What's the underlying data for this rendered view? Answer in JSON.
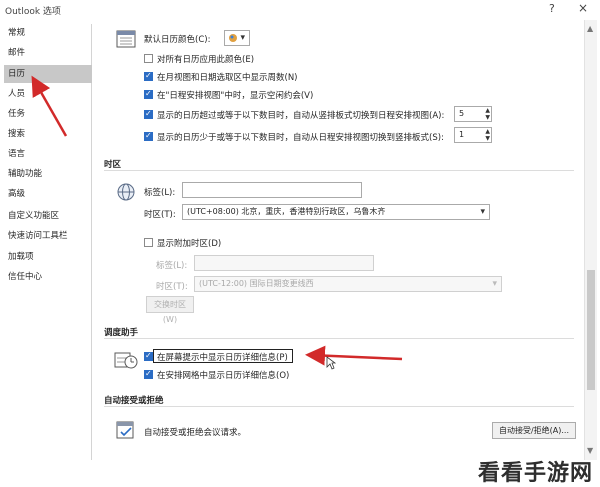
{
  "window": {
    "title": "Outlook 选项",
    "help": "?",
    "close": "×"
  },
  "sidebar": {
    "items": [
      {
        "label": "常规"
      },
      {
        "label": "邮件"
      },
      {
        "label": "日历"
      },
      {
        "label": "人员"
      },
      {
        "label": "任务"
      },
      {
        "label": "搜索"
      },
      {
        "label": "语言"
      },
      {
        "label": "辅助功能"
      },
      {
        "label": "高级"
      },
      {
        "label": "自定义功能区"
      },
      {
        "label": "快速访问工具栏"
      },
      {
        "label": "加载项"
      },
      {
        "label": "信任中心"
      }
    ],
    "active_index": 2
  },
  "display": {
    "default_color_label": "默认日历颜色(C):",
    "apply_all_label": "对所有日历应用此颜色(E)",
    "show_week_numbers_label": "在月视图和日期选取区中显示周数(N)",
    "show_free_label": "在\"日程安排视图\"中时，显示空闲约会(V)",
    "switch_when_more_label": "显示的日历超过或等于以下数目时，自动从竖排板式切换到日程安排视图(A):",
    "switch_when_more_value": "5",
    "switch_when_less_label": "显示的日历少于或等于以下数目时，自动从日程安排视图切换到竖排板式(S):",
    "switch_when_less_value": "1"
  },
  "timezone": {
    "section": "时区",
    "label_label": "标签(L):",
    "label_value": "",
    "zone_label": "时区(T):",
    "zone_value": "(UTC+08:00) 北京，重庆，香港特别行政区，乌鲁木齐",
    "show_second_label": "显示附加时区(D)",
    "second_label_label": "标签(L):",
    "second_zone_label": "时区(T):",
    "second_zone_value": "(UTC-12:00) 国际日期变更线西",
    "swap_button": "交换时区(W)"
  },
  "scheduling": {
    "section": "调度助手",
    "show_details_tip_label": "在屏幕提示中显示日历详细信息(P)",
    "show_details_grid_label": "在安排网格中显示日历详细信息(O)"
  },
  "auto_accept": {
    "section": "自动接受或拒绝",
    "desc": "自动接受或拒绝会议请求。",
    "button": "自动接受/拒绝(A)..."
  },
  "watermark": "看看手游网",
  "colors": {
    "accent": "#2b6cc4",
    "arrow": "#d22a2a",
    "active_nav": "#c8c8c8"
  }
}
